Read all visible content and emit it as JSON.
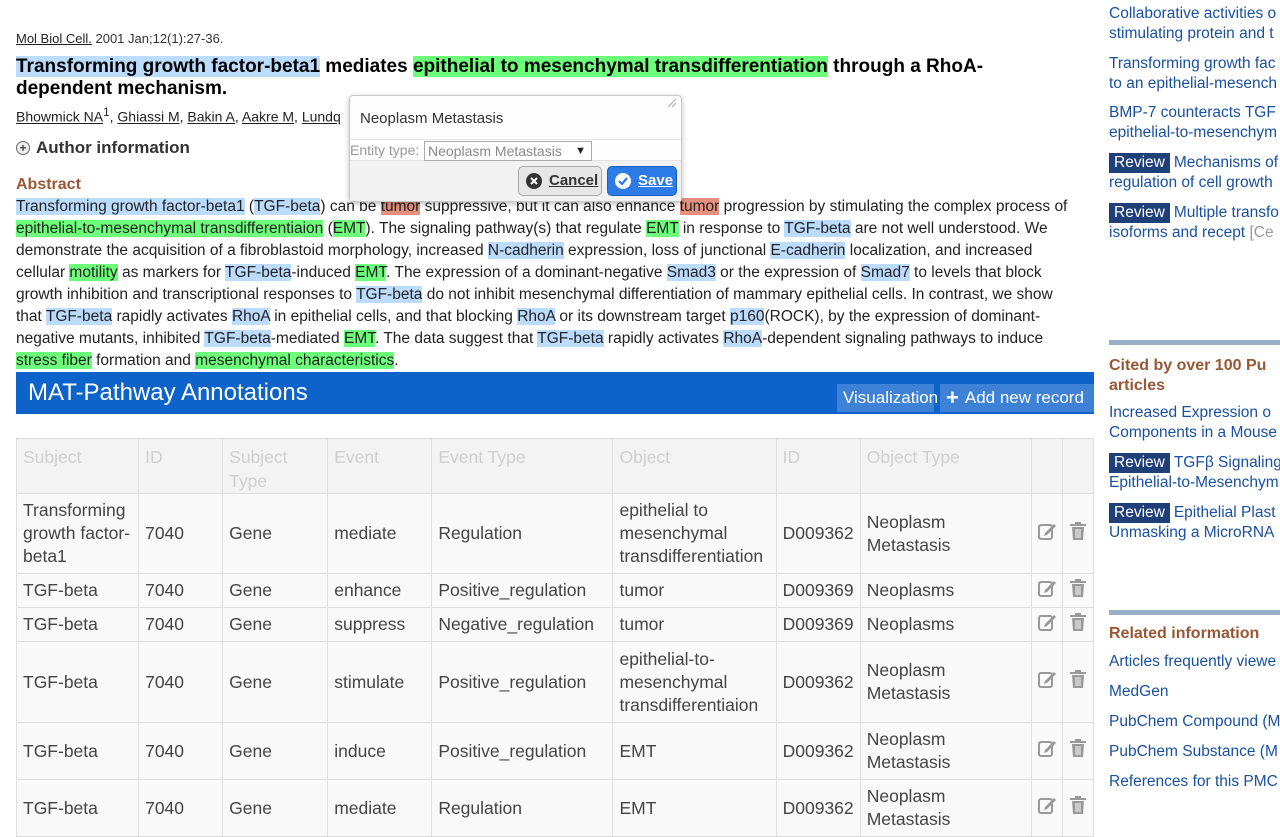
{
  "article": {
    "journal": "Mol Biol Cell.",
    "date_ref": "2001 Jan;12(1):27-36.",
    "title_parts": {
      "t1": "Transforming growth factor-beta1",
      "t2": " mediates ",
      "t3": "epithelial to mesenchymal transdifferentiation",
      "t4": " through a RhoA-dependent mechanism."
    },
    "authors": {
      "a1": "Bhowmick NA",
      "a1_sup": "1",
      "a2": "Ghiassi M",
      "a3": "Bakin A",
      "a4": "Aakre M",
      "a5": "Lundq"
    },
    "author_info_label": "Author information",
    "abstract_heading": "Abstract",
    "abstract": {
      "s1": "Transforming growth factor-beta1",
      "s2": " (",
      "s3": "TGF-beta",
      "s4": ") can be ",
      "s5": "tumor",
      "s6": " suppressive, but it can also enhance ",
      "s7": "tumor",
      "s8": " progression by stimulating the complex process of ",
      "s9": "epithelial-to-mesenchymal transdifferentiaion",
      "s10": " (",
      "s11": "EMT",
      "s12": "). The signaling pathway(s) that regulate ",
      "s13": "EMT",
      "s14": " in response to ",
      "s15": "TGF-beta",
      "s16": " are not well understood. We demonstrate the acquisition of a fibroblastoid morphology, increased ",
      "s17": "N-cadherin",
      "s18": " expression, loss of junctional ",
      "s19": "E-cadherin",
      "s20": " localization, and increased cellular ",
      "s21": "motility",
      "s22": " as markers for ",
      "s23": "TGF-beta",
      "s24": "-induced ",
      "s25": "EMT",
      "s26": ". The expression of a dominant-negative ",
      "s27": "Smad3",
      "s28": " or the expression of ",
      "s29": "Smad7",
      "s30": " to levels that block growth inhibition and transcriptional responses to ",
      "s31": "TGF-beta",
      "s32": " do not inhibit mesenchymal differentiation of mammary epithelial cells. In contrast, we show that ",
      "s33": "TGF-beta",
      "s34": " rapidly activates ",
      "s35": "RhoA",
      "s36": " in epithelial cells, and that blocking ",
      "s37": "RhoA",
      "s38": " or its downstream target ",
      "s39": "p160",
      "s40": "(ROCK), by the expression of dominant-negative mutants, inhibited ",
      "s41": "TGF-beta",
      "s42": "-mediated ",
      "s43": "EMT",
      "s44": ". The data suggest that ",
      "s45": "TGF-beta",
      "s46": " rapidly activates ",
      "s47": "RhoA",
      "s48": "-dependent signaling pathways to induce ",
      "s49": "stress fiber",
      "s50": " formation and ",
      "s51": "mesenchymal characteristics",
      "s52": "."
    }
  },
  "popup": {
    "entity_text": "Neoplasm Metastasis",
    "type_label": "Entity type:",
    "type_value": "Neoplasm Metastasis",
    "cancel_label": "Cancel",
    "save_label": "Save"
  },
  "annotations": {
    "heading": "MAT-Pathway Annotations",
    "visualization_label": "Visualization",
    "add_record_label": "Add new record",
    "columns": [
      "Subject",
      "ID",
      "Subject Type",
      "Event",
      "Event Type",
      "Object",
      "ID",
      "Object Type"
    ],
    "rows": [
      [
        "Transforming growth factor-beta1",
        "7040",
        "Gene",
        "mediate",
        "Regulation",
        "epithelial to mesenchymal transdifferentiation",
        "D009362",
        "Neoplasm Metastasis"
      ],
      [
        "TGF-beta",
        "7040",
        "Gene",
        "enhance",
        "Positive_regulation",
        "tumor",
        "D009369",
        "Neoplasms"
      ],
      [
        "TGF-beta",
        "7040",
        "Gene",
        "suppress",
        "Negative_regulation",
        "tumor",
        "D009369",
        "Neoplasms"
      ],
      [
        "TGF-beta",
        "7040",
        "Gene",
        "stimulate",
        "Positive_regulation",
        "epithelial-to-mesenchymal transdifferentiaion",
        "D009362",
        "Neoplasm Metastasis"
      ],
      [
        "TGF-beta",
        "7040",
        "Gene",
        "induce",
        "Positive_regulation",
        "EMT",
        "D009362",
        "Neoplasm Metastasis"
      ],
      [
        "TGF-beta",
        "7040",
        "Gene",
        "mediate",
        "Regulation",
        "EMT",
        "D009362",
        "Neoplasm Metastasis"
      ]
    ]
  },
  "sidebar": {
    "similar": [
      {
        "line1": "Collaborative activities o",
        "line2": "stimulating protein and t"
      },
      {
        "line1": "Transforming growth fac",
        "line2": "to an epithelial-mesench"
      },
      {
        "line1": "BMP-7 counteracts TGF",
        "line2": "epithelial-to-mesenchym"
      },
      {
        "badge": "Review",
        "line1": "Mechanisms of",
        "line2": "regulation of cell growth"
      },
      {
        "badge": "Review",
        "line1": "Multiple transfo",
        "line2": "isoforms and recept",
        "more": "[Ce"
      }
    ],
    "cited_heading": "Cited by over 100 Pu articles",
    "cited": [
      {
        "line1": "Increased Expression o",
        "line2": "Components in a Mouse"
      },
      {
        "badge": "Review",
        "line1": "TGFβ Signaling",
        "line2": "Epithelial-to-Mesenchym"
      },
      {
        "badge": "Review",
        "line1": "Epithelial Plast",
        "line2": "Unmasking a MicroRNA"
      }
    ],
    "related_heading": "Related information",
    "related": [
      "Articles frequently viewe",
      "MedGen",
      "PubChem Compound (M",
      "PubChem Substance (M",
      "References for this PMC"
    ]
  },
  "colors": {
    "entity_gene": "#bcdcff",
    "entity_disease_match": "#6eff7a",
    "entity_other": "#e6917f",
    "annotation_bar": "#0d63c9",
    "section_heading": "#985735"
  }
}
